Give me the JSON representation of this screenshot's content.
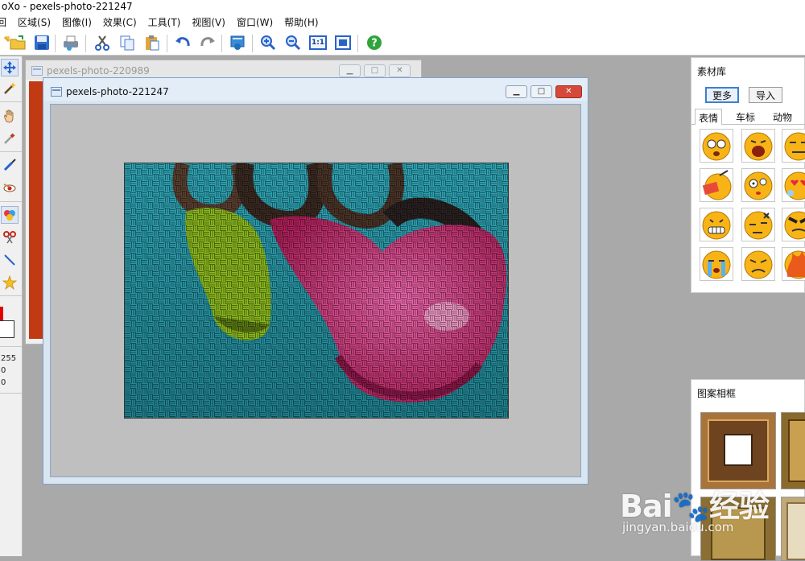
{
  "app": {
    "title": "oXo - pexels-photo-221247"
  },
  "menu": [
    "回",
    "区域(S)",
    "图像(I)",
    "效果(C)",
    "工具(T)",
    "视图(V)",
    "窗口(W)",
    "帮助(H)"
  ],
  "toolbar": {
    "icons": [
      "new-icon",
      "open-icon",
      "save-icon",
      "print-icon",
      "cut-icon",
      "copy-icon",
      "paste-icon",
      "undo-icon",
      "redo-icon",
      "batch-icon",
      "zoom-in-icon",
      "zoom-out-icon",
      "actual-size-icon",
      "fit-window-icon",
      "help-icon"
    ],
    "actual_size_label": "1:1"
  },
  "tools": [
    "move-icon",
    "magic-wand-icon",
    "hand-icon",
    "eyedropper-icon",
    "brush-icon",
    "red-eye-icon",
    "fill-icon",
    "clone-icon",
    "line-icon",
    "star-icon"
  ],
  "color": {
    "foreground": "#e00000",
    "background": "#ffffff",
    "values": [
      "255",
      "0",
      "0"
    ]
  },
  "windows": {
    "back": {
      "title": "pexels-photo-220989",
      "buttons": [
        "▁",
        "□",
        "✕"
      ]
    },
    "main": {
      "title": "pexels-photo-221247",
      "buttons": [
        "▁",
        "□",
        "✕"
      ]
    }
  },
  "material_panel": {
    "title": "素材库",
    "buttons": [
      "更多",
      "导入"
    ],
    "tabs": [
      "表情",
      "车标",
      "动物"
    ],
    "active_tab": 0
  },
  "frame_panel": {
    "title": "图案相框"
  },
  "watermark": {
    "brand": "Bai🐾经验",
    "url": "jingyan.baidu.com"
  },
  "colors": {
    "accent": "#3c7fd0",
    "close": "#d5493a",
    "photo_bg": "#2a98a8",
    "pink": "#d0306e",
    "green": "#8ab81e"
  }
}
